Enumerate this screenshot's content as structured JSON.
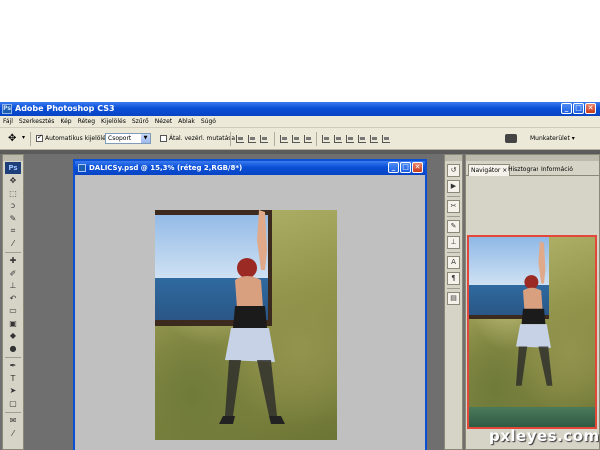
{
  "app": {
    "title": "Adobe Photoshop CS3",
    "ps_badge": "Ps",
    "window_buttons": {
      "minimize": "_",
      "maximize": "□",
      "close": "✕"
    }
  },
  "menu": [
    "Fájl",
    "Szerkesztés",
    "Kép",
    "Réteg",
    "Kijelölés",
    "Szűrő",
    "Nézet",
    "Ablak",
    "Súgó"
  ],
  "options": {
    "auto_select_label": "Automatikus kijelölés:",
    "auto_select_checked": true,
    "group_value": "Csoport",
    "transform_label": "Átal. vezérl. mutatása",
    "transform_checked": false,
    "workspace_label": "Munkaterület ▾"
  },
  "document": {
    "title": "DALICSy.psd @ 15,3% (réteg 2,RGB/8*)"
  },
  "panels": {
    "tabs": [
      "Navigátor",
      "Hisztogram",
      "Információ"
    ],
    "active_tab": "Navigátor",
    "tab_close": "×"
  },
  "colors": {
    "titlebar": "#0a4fd6",
    "panel_bg": "#d6d3c7",
    "navigator_frame": "#e2473a"
  },
  "watermark": "pxleyes.com"
}
